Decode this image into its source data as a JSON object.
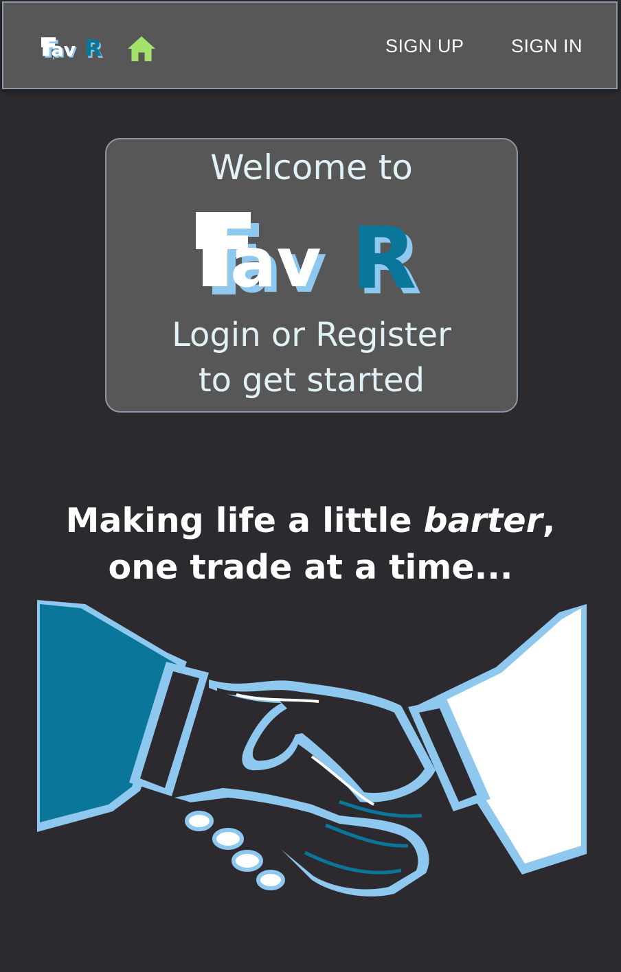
{
  "navbar": {
    "logo_text": "FlavR",
    "home_icon": "home-icon",
    "links": [
      {
        "label": "SIGN UP"
      },
      {
        "label": "SIGN IN"
      }
    ]
  },
  "welcome": {
    "title": "Welcome to",
    "logo_text": "FlavR",
    "line1": "Login or Register",
    "line2": "to get started"
  },
  "tagline": {
    "part1": "Making life a little ",
    "emphasis": "barter",
    "part2": ",",
    "line2": "one trade at a time..."
  },
  "illustration": {
    "icon": "handshake-illustration"
  },
  "colors": {
    "background": "#2c2a2e",
    "panel": "#575757",
    "border": "#8c97a8",
    "text_light": "#e1f1f6",
    "home_green": "#a3e26b",
    "brand_teal": "#0a7699",
    "brand_light_blue": "#8fc8ef"
  }
}
